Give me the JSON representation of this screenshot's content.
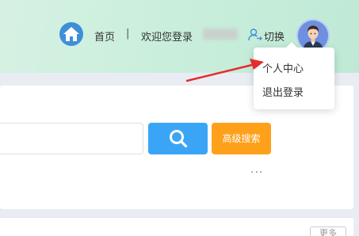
{
  "header": {
    "home_icon": "home-icon",
    "home_label": "首页",
    "separator": "|",
    "welcome_text": "欢迎您登录",
    "switch_icon": "user-switch-icon",
    "switch_label": "切换",
    "avatar_icon": "user-avatar"
  },
  "dropdown": {
    "items": [
      {
        "label": "个人中心"
      },
      {
        "label": "退出登录"
      }
    ]
  },
  "search": {
    "placeholder": "",
    "search_icon": "search-icon",
    "advanced_label": "高级搜索"
  },
  "more": {
    "label": "···"
  },
  "corner_button": {
    "label": "更多"
  },
  "colors": {
    "header_bg": "#c8eedb",
    "search_blue": "#3aa5f7",
    "advanced_orange": "#ffa01a",
    "annotation_red": "#e52b2b"
  }
}
